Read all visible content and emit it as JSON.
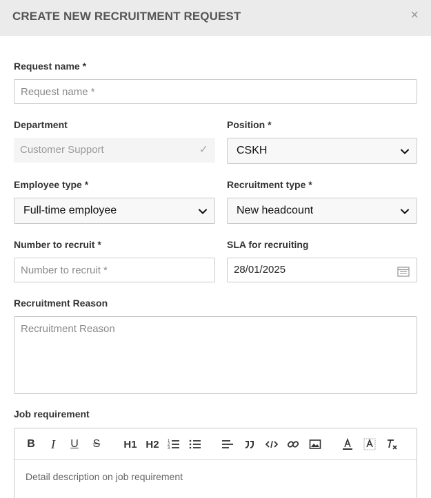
{
  "modal": {
    "title": "CREATE NEW RECRUITMENT REQUEST",
    "close": "×"
  },
  "form": {
    "request_name": {
      "label": "Request name *",
      "placeholder": "Request name *",
      "value": ""
    },
    "department": {
      "label": "Department",
      "value": "Customer Support"
    },
    "position": {
      "label": "Position *",
      "value": "CSKH"
    },
    "employee_type": {
      "label": "Employee type *",
      "value": "Full-time employee"
    },
    "recruitment_type": {
      "label": "Recruitment type *",
      "value": "New headcount"
    },
    "number_to_recruit": {
      "label": "Number to recruit *",
      "placeholder": "Number to recruit *",
      "value": ""
    },
    "sla": {
      "label": "SLA for recruiting",
      "value": "28/01/2025"
    },
    "recruitment_reason": {
      "label": "Recruitment Reason",
      "placeholder": "Recruitment Reason"
    },
    "job_requirement": {
      "label": "Job requirement",
      "placeholder": "Detail description on job requirement"
    }
  },
  "toolbar": {
    "bold": "B",
    "italic": "I",
    "underline": "U",
    "strike": "S",
    "h1": "H1",
    "h2": "H2"
  }
}
